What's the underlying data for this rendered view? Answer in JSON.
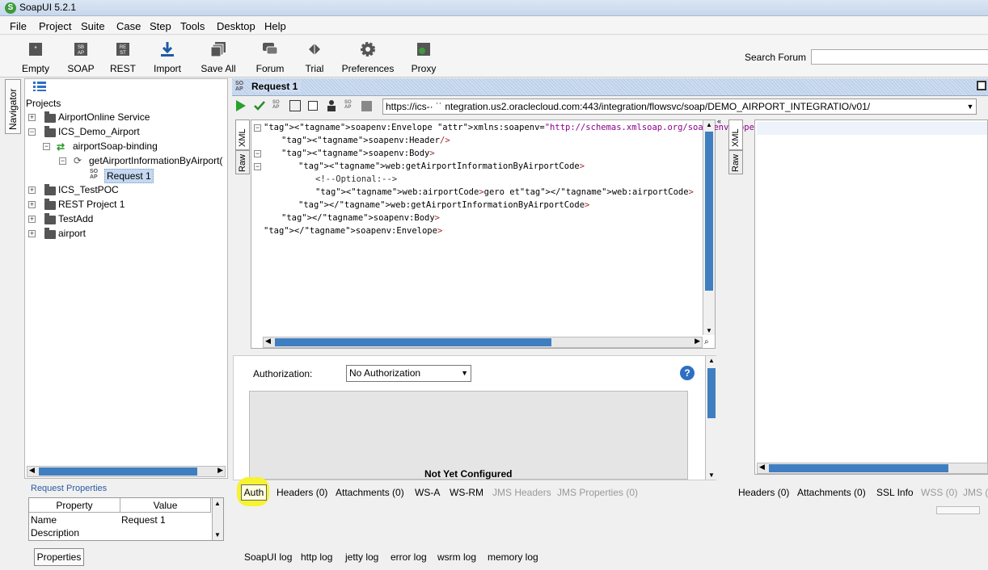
{
  "window": {
    "title": "SoapUI 5.2.1"
  },
  "menu": [
    "File",
    "Project",
    "Suite",
    "Case",
    "Step",
    "Tools",
    "Desktop",
    "Help"
  ],
  "toolbar": {
    "buttons": [
      "Empty",
      "SOAP",
      "REST",
      "Import",
      "Save All",
      "Forum",
      "Trial",
      "Preferences",
      "Proxy"
    ],
    "search_label": "Search Forum",
    "search_value": ""
  },
  "navigator": {
    "tab_label": "Navigator"
  },
  "tree": {
    "root": "Projects",
    "items": [
      "AirportOnline Service",
      "ICS_Demo_Airport",
      "airportSoap-binding",
      "getAirportInformationByAirport(",
      "Request 1",
      "ICS_TestPOC",
      "REST Project 1",
      "TestAdd",
      "airport"
    ]
  },
  "request_properties": {
    "title": "Request Properties",
    "columns": [
      "Property",
      "Value"
    ],
    "rows": [
      {
        "property": "Name",
        "value": "Request 1"
      },
      {
        "property": "Description",
        "value": ""
      }
    ],
    "button": "Properties"
  },
  "request": {
    "title": "Request 1",
    "url": "https://ics-·  ˙˙       ntegration.us2.oraclecloud.com:443/integration/flowsvc/soap/DEMO_AIRPORT_INTEGRATIO/v01/",
    "editor_tabs": [
      "XML",
      "Raw"
    ],
    "xml_lines": [
      "<soapenv:Envelope xmlns:soapenv=\"http://schemas.xmlsoap.org/soap/envelope/\" xm",
      "<soapenv:Header/>",
      "<soapenv:Body>",
      "<web:getAirportInformationByAirportCode>",
      "<!--Optional:-->",
      "<web:airportCode>gero et</web:airportCode>",
      "</web:getAirportInformationByAirportCode>",
      "</soapenv:Body>",
      "</soapenv:Envelope>"
    ]
  },
  "auth": {
    "label": "Authorization:",
    "selected": "No Authorization",
    "status": "Not Yet Configured"
  },
  "request_tabs": [
    "Auth",
    "Headers (0)",
    "Attachments (0)",
    "WS-A",
    "WS-RM",
    "JMS Headers",
    "JMS Properties (0)"
  ],
  "response": {
    "editor_tabs": [
      "XML",
      "Raw"
    ],
    "tabs": [
      "Headers (0)",
      "Attachments (0)",
      "SSL Info",
      "WSS (0)",
      "JMS ("
    ]
  },
  "logs": [
    "SoapUI log",
    "http log",
    "jetty log",
    "error log",
    "wsrm log",
    "memory log"
  ]
}
